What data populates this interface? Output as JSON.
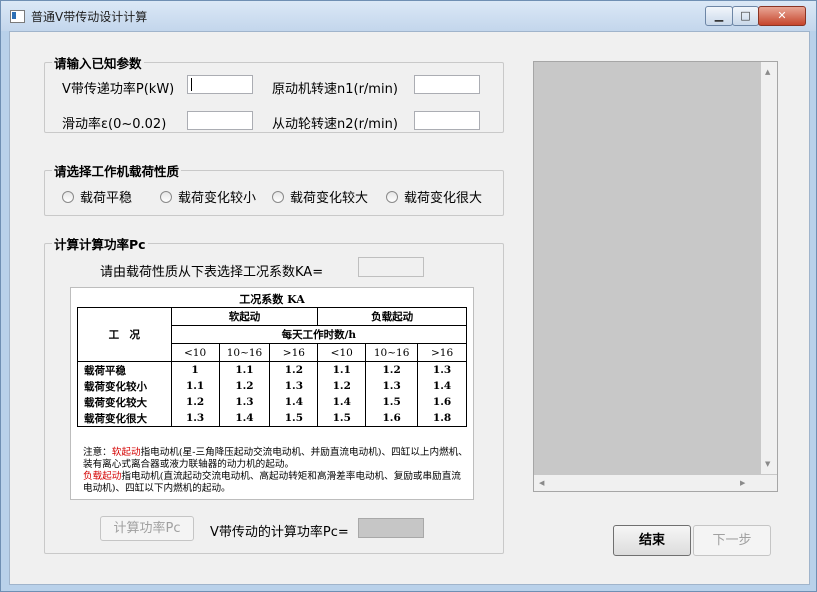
{
  "window": {
    "title": "普通V带传动设计计算",
    "min_icon": "minimize-icon",
    "max_icon": "maximize-icon",
    "close_icon": "close-icon",
    "min_glyph": "▁",
    "max_glyph": "□",
    "close_glyph": "✕"
  },
  "known_params": {
    "legend": "请输入已知参数",
    "power_label": "V带传递功率P(kW)",
    "power_value": "",
    "n1_label": "原动机转速n1(r/min)",
    "n1_value": "",
    "slip_label": "滑动率ε(0~0.02)",
    "slip_value": "",
    "n2_label": "从动轮转速n2(r/min)",
    "n2_value": ""
  },
  "load_nature": {
    "legend": "请选择工作机载荷性质",
    "options": [
      "载荷平稳",
      "载荷变化较小",
      "载荷变化较大",
      "载荷变化很大"
    ]
  },
  "calc_power": {
    "legend": "计算计算功率Pc",
    "ka_prompt": "请由载荷性质从下表选择工况系数KA=",
    "ka_value": "",
    "calc_button": "计算功率Pc",
    "pc_label": "V带传动的计算功率Pc=",
    "pc_value": ""
  },
  "ka_table": {
    "caption": "工况系数 KA",
    "corner": "工　况",
    "soft_start": "软起动",
    "load_start": "负载起动",
    "hours_header": "每天工作时数/h",
    "hours": [
      "<10",
      "10~16",
      ">16",
      "<10",
      "10~16",
      ">16"
    ],
    "rows": [
      {
        "label": "载荷平稳",
        "values": [
          "1",
          "1.1",
          "1.2",
          "1.1",
          "1.2",
          "1.3"
        ]
      },
      {
        "label": "载荷变化较小",
        "values": [
          "1.1",
          "1.2",
          "1.3",
          "1.2",
          "1.3",
          "1.4"
        ]
      },
      {
        "label": "载荷变化较大",
        "values": [
          "1.2",
          "1.3",
          "1.4",
          "1.4",
          "1.5",
          "1.6"
        ]
      },
      {
        "label": "载荷变化很大",
        "values": [
          "1.3",
          "1.4",
          "1.5",
          "1.5",
          "1.6",
          "1.8"
        ]
      }
    ],
    "note_prefix": "注意：",
    "note_soft_term": "软起动",
    "note_soft_text": "指电动机(星-三角降压起动交流电动机、并励直流电动机)、四缸以上内燃机、装有离心式离合器或液力联轴器的动力机的起动。",
    "note_load_term": "负载起动",
    "note_load_text": "指电动机(直流起动交流电动机、高起动转矩和高滑差率电动机、复励或串励直流电动机)、四缸以下内燃机的起动。",
    "colors": {
      "note_highlight": "#d40000"
    }
  },
  "buttons": {
    "finish": "结束",
    "next": "下一步"
  },
  "scroll": {
    "up_glyph": "▲",
    "down_glyph": "▼",
    "left_glyph": "◀",
    "right_glyph": "▶"
  }
}
